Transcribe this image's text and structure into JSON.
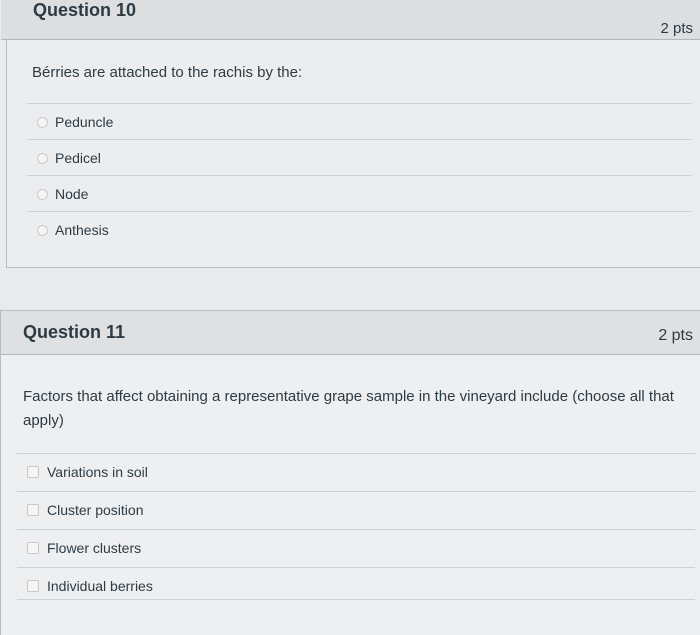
{
  "question10": {
    "title": "Question 10",
    "points": "2 pts",
    "prompt": "Bérries are attached to the rachis by the:",
    "options": [
      {
        "label": "Peduncle"
      },
      {
        "label": "Pedicel"
      },
      {
        "label": "Node"
      },
      {
        "label": "Anthesis"
      }
    ]
  },
  "question11": {
    "title": "Question 11",
    "points": "2 pts",
    "prompt": "Factors that affect obtaining a representative grape sample in the vineyard include (choose all that apply)",
    "options": [
      {
        "label": "Variations in soil"
      },
      {
        "label": "Cluster position"
      },
      {
        "label": "Flower clusters"
      },
      {
        "label": "Individual berries"
      }
    ]
  },
  "colors": {
    "text": "#2d3b45",
    "header_bg": "#dcdee0",
    "body_bg": "#ecedef",
    "divider": "#cfd1d4"
  }
}
